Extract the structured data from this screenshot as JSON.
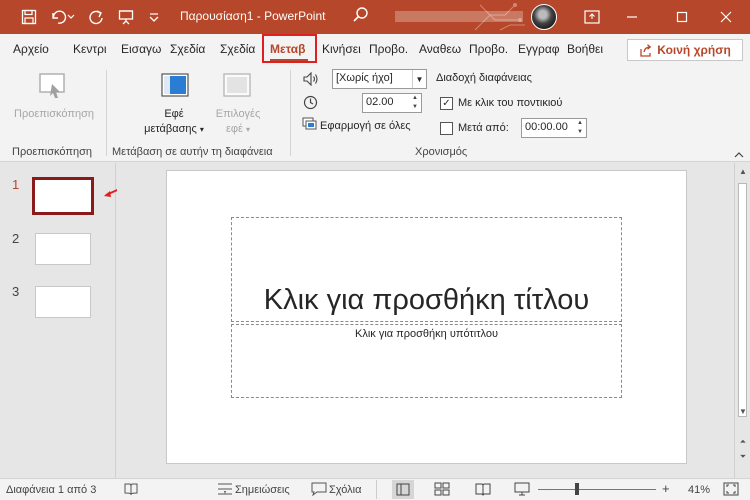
{
  "titlebar": {
    "title": "Παρουσίαση1  -  PowerPoint",
    "bg_color": "#b7472a"
  },
  "tabs": [
    {
      "label": "Αρχείο"
    },
    {
      "label": "Κεντρι"
    },
    {
      "label": "Εισαγω"
    },
    {
      "label": "Σχεδία"
    },
    {
      "label": "Σχεδία"
    },
    {
      "label": "Μεταβ"
    },
    {
      "label": "Κινήσει"
    },
    {
      "label": "Προβο."
    },
    {
      "label": "Αναθεω"
    },
    {
      "label": "Προβο."
    },
    {
      "label": "Εγγραφ"
    },
    {
      "label": "Βοήθει"
    }
  ],
  "share_label": "Κοινή χρήση",
  "ribbon": {
    "preview_label": "Προεπισκόπηση",
    "effects_label_1": "Εφέ",
    "effects_label_2": "μετάβασης",
    "options_label_1": "Επιλογές",
    "options_label_2": "εφέ",
    "sound_value": "[Χωρίς ήχο]",
    "duration_value": "02.00",
    "apply_all_label": "Εφαρμογή σε όλες",
    "advance_title": "Διαδοχή διαφάνειας",
    "on_click_label": "Με κλικ του ποντικιού",
    "on_click_checked": true,
    "after_label": "Μετά από:",
    "after_checked": false,
    "after_value": "00:00.00",
    "group_preview": "Προεπισκόπηση",
    "group_transition": "Μετάβαση σε αυτήν τη διαφάνεια",
    "group_timing": "Χρονισμός"
  },
  "thumbnails": [
    {
      "num": "1",
      "active": true
    },
    {
      "num": "2",
      "active": false
    },
    {
      "num": "3",
      "active": false
    }
  ],
  "slide": {
    "title_placeholder": "Κλικ για προσθήκη τίτλου",
    "subtitle_placeholder": "Κλικ για προσθήκη υπότιτλου"
  },
  "statusbar": {
    "slide_info": "Διαφάνεια 1 από 3",
    "notes_label": "Σημειώσεις",
    "comments_label": "Σχόλια",
    "zoom": "41%"
  },
  "colors": {
    "accent": "#b7472a",
    "highlight": "#e02020",
    "thumb_active_border": "#8b1b1b"
  }
}
